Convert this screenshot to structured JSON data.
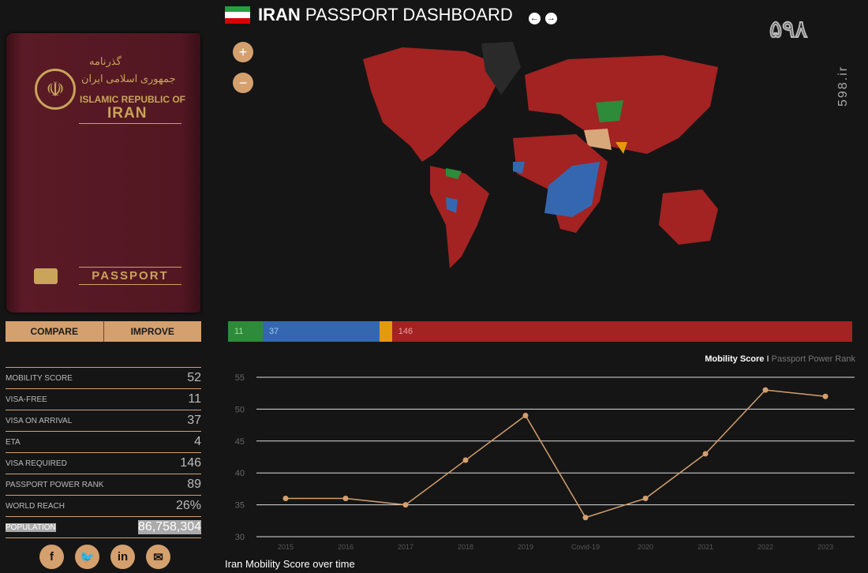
{
  "header": {
    "title_bold": "IRAN",
    "title_rest": "PASSPORT DASHBOARD",
    "prev_icon": "arrow-left-circle",
    "next_icon": "arrow-right-circle"
  },
  "watermark": {
    "logo": "۵۹۸",
    "site": "598.ir"
  },
  "passport": {
    "persian_title": "گذرنامه",
    "persian_country": "جمهوری اسلامی ایران",
    "country_en": "ISLAMIC REPUBLIC OF",
    "country_name": "IRAN",
    "label": "PASSPORT"
  },
  "buttons": {
    "compare": "COMPARE",
    "improve": "IMPROVE"
  },
  "map_controls": {
    "zoom_in": "+",
    "zoom_out": "−"
  },
  "stats": [
    {
      "label": "MOBILITY SCORE",
      "value": "52"
    },
    {
      "label": "VISA-FREE",
      "value": "11"
    },
    {
      "label": "VISA ON ARRIVAL",
      "value": "37"
    },
    {
      "label": "ETA",
      "value": "4"
    },
    {
      "label": "VISA REQUIRED",
      "value": "146"
    },
    {
      "label": "PASSPORT POWER RANK",
      "value": "89"
    },
    {
      "label": "WORLD REACH",
      "value": "26%"
    },
    {
      "label": "POPULATION",
      "value": "86,758,304"
    }
  ],
  "social": [
    "facebook",
    "twitter",
    "linkedin",
    "email"
  ],
  "breakdown": [
    {
      "value": 11,
      "label": "11",
      "color": "#2e8b3a"
    },
    {
      "value": 37,
      "label": "37",
      "color": "#3567b0"
    },
    {
      "value": 4,
      "label": "",
      "color": "#e39a0c"
    },
    {
      "value": 146,
      "label": "146",
      "color": "#a32222"
    }
  ],
  "toggle": {
    "active": "Mobility Score",
    "separator": "I",
    "inactive": "Passport Power Rank"
  },
  "chart_data": {
    "type": "line",
    "title": "Iran Mobility Score over time",
    "categories": [
      "2015",
      "2016",
      "2017",
      "2018",
      "2019",
      "Covid-19",
      "2020",
      "2021",
      "2022",
      "2023"
    ],
    "values": [
      36,
      36,
      35,
      42,
      49,
      33,
      36,
      43,
      53,
      52
    ],
    "ylim": [
      30,
      55
    ],
    "yticks": [
      30,
      35,
      40,
      45,
      50,
      55
    ],
    "grid": true,
    "color": "#d4a06e"
  }
}
